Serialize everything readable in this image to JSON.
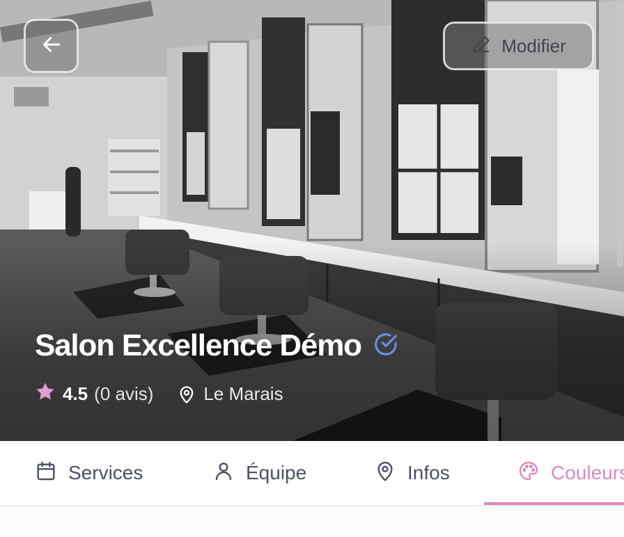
{
  "header": {
    "back_icon": "arrow-left-icon",
    "edit_label": "Modifier",
    "edit_icon": "pencil-icon"
  },
  "salon": {
    "name": "Salon Excellence Démo",
    "verified_icon": "verified-check-icon",
    "rating": "4.5",
    "reviews": "(0 avis)",
    "location": "Le Marais",
    "rating_icon": "star-icon",
    "location_icon": "map-pin-icon"
  },
  "tabs": [
    {
      "label": "Services",
      "icon": "calendar-icon",
      "active": false
    },
    {
      "label": "Équipe",
      "icon": "user-icon",
      "active": false
    },
    {
      "label": "Infos",
      "icon": "map-pin-icon",
      "active": false
    },
    {
      "label": "Couleurs",
      "icon": "palette-icon",
      "active": true
    }
  ],
  "colors": {
    "accent": "#d98ac0",
    "verified": "#6c8fe0",
    "tab_text": "#4a5160",
    "star": "#e29bd0"
  }
}
